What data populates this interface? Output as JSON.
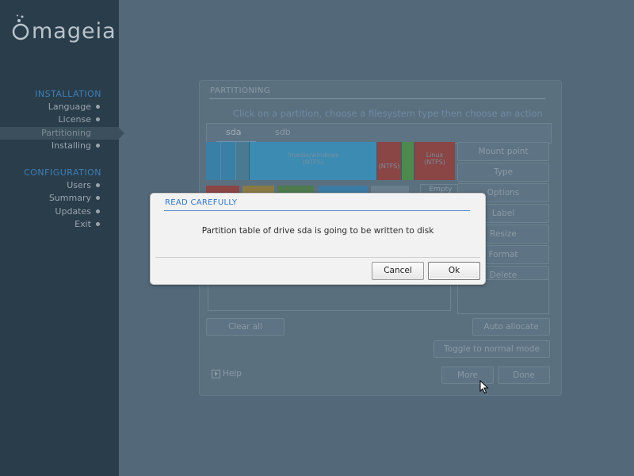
{
  "sidebar": {
    "logo_text": "mageia",
    "sections": [
      {
        "title": "INSTALLATION",
        "items": [
          "Language",
          "License",
          "Partitioning",
          "Installing"
        ]
      },
      {
        "title": "CONFIGURATION",
        "items": [
          "Users",
          "Summary",
          "Updates",
          "Exit"
        ]
      }
    ],
    "active_item": "Partitioning"
  },
  "partitioning": {
    "title": "PARTITIONING",
    "instruction": "Click on a partition, choose a filesystem type then choose an action",
    "tabs": [
      "sda",
      "sdb"
    ],
    "active_tab": "sda",
    "partitions": [
      {
        "label": "/media/windows\n(NTFS)",
        "color": "#3a8fc0"
      },
      {
        "label": "(NTFS)",
        "color": "#9a3a3a"
      },
      {
        "label": "",
        "color": "#4a8a4a"
      },
      {
        "label": "Linux\n(NTFS)",
        "color": "#9a3a3a"
      }
    ],
    "legend_empty": "Empty",
    "actions": [
      "Mount point",
      "Type",
      "Options",
      "Label",
      "Resize",
      "Format",
      "Delete"
    ],
    "clear_all": "Clear all",
    "auto_allocate": "Auto allocate",
    "toggle_mode": "Toggle to normal mode",
    "help": "Help",
    "more": "More",
    "done": "Done"
  },
  "dialog": {
    "title": "READ CAREFULLY",
    "message": "Partition table of drive sda is going to be written to disk",
    "cancel": "Cancel",
    "ok": "Ok"
  },
  "colors": {
    "accent": "#2f76c6",
    "sidebar_bg": "#2a3d4b",
    "background": "#53697a"
  }
}
